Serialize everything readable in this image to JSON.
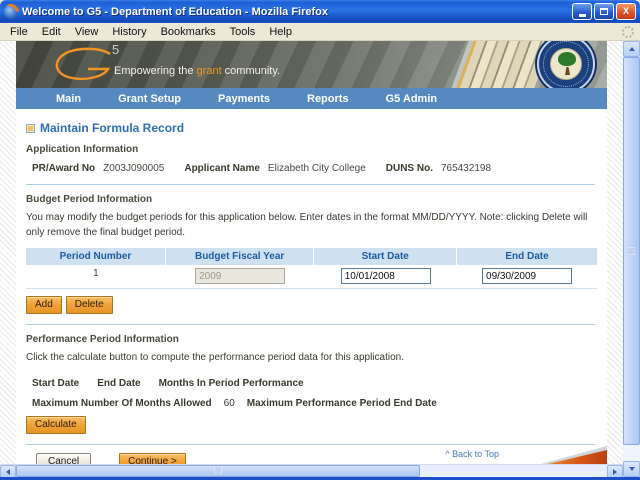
{
  "window": {
    "title": "Welcome to G5 - Department of Education - Mozilla Firefox",
    "menu_items": [
      "File",
      "Edit",
      "View",
      "History",
      "Bookmarks",
      "Tools",
      "Help"
    ]
  },
  "banner": {
    "logo_5": "5",
    "tagline_prefix": "Empowering the ",
    "tagline_highlight": "grant",
    "tagline_suffix": " community."
  },
  "nav": {
    "items": [
      "Main",
      "Grant Setup",
      "Payments",
      "Reports",
      "G5 Admin"
    ]
  },
  "page": {
    "title": "Maintain Formula Record",
    "application_info": {
      "heading": "Application Information",
      "fields": [
        {
          "label": "PR/Award No",
          "value": "Z003J090005"
        },
        {
          "label": "Applicant Name",
          "value": "Elizabeth City College"
        },
        {
          "label": "DUNS No.",
          "value": "765432198"
        }
      ]
    },
    "budget_period": {
      "heading": "Budget Period Information",
      "instructions": "You may modify the budget periods for this application below. Enter dates in the format MM/DD/YYYY. Note: clicking Delete will only remove the final budget period.",
      "table": {
        "headers": [
          "Period Number",
          "Budget Fiscal Year",
          "Start Date",
          "End Date"
        ],
        "rows": [
          {
            "period": "1",
            "fiscal_year": "2009",
            "start_date": "10/01/2008",
            "end_date": "09/30/2009"
          }
        ]
      },
      "add_button": "Add",
      "delete_button": "Delete"
    },
    "performance_period": {
      "heading": "Performance Period Information",
      "instructions": "Click the calculate button to compute the performance period data for this application.",
      "labels": [
        "Start Date",
        "End Date",
        "Months In Period Performance"
      ],
      "max_months_label": "Maximum Number Of Months Allowed",
      "max_months_value": "60",
      "max_end_date_label": "Maximum Performance Period End Date",
      "calculate_button": "Calculate"
    },
    "actions": {
      "cancel": "Cancel",
      "continue": "Continue >"
    },
    "back_to_top": "^ Back to Top"
  },
  "colors": {
    "accent_orange": "#ee9526",
    "nav_blue": "#5689c0",
    "table_header_bg": "#cfe1f0",
    "table_header_text": "#1e5b9e",
    "link_blue": "#4a7ab5",
    "button_orange": "#f0a138"
  }
}
